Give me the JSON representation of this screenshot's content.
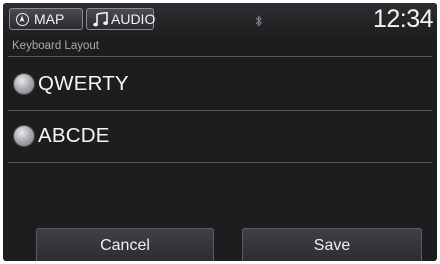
{
  "status_bar": {
    "map_label": "MAP",
    "audio_label": "AUDIO",
    "clock": "12:34"
  },
  "page": {
    "title": "Keyboard Layout"
  },
  "options": [
    {
      "label": "QWERTY",
      "icon": "radio-icon"
    },
    {
      "label": "ABCDE",
      "icon": "radio-icon"
    }
  ],
  "actions": {
    "cancel_label": "Cancel",
    "save_label": "Save"
  },
  "colors": {
    "background": "#1c1d1f",
    "text": "#f6f6f6",
    "muted_text": "#a8aaae",
    "divider": "#55575b"
  }
}
